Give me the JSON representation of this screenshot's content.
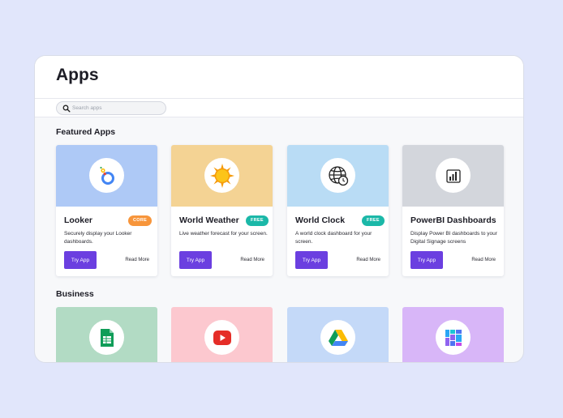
{
  "header": {
    "title": "Apps"
  },
  "search": {
    "placeholder": "Search apps",
    "icon": "search-icon"
  },
  "sections": {
    "featured": "Featured Apps",
    "business": "Business"
  },
  "featured_apps": [
    {
      "name": "Looker",
      "badge": "CORE",
      "badge_color": "#f7953b",
      "bg": "#aec9f6",
      "icon": "looker-icon",
      "desc": "Securely display your Looker dashboards.",
      "try": "Try App",
      "more": "Read More"
    },
    {
      "name": "World Weather",
      "badge": "FREE",
      "badge_color": "#1bb8a8",
      "bg": "#f4d394",
      "icon": "sun-icon",
      "desc": "Live weather forecast for your screen.",
      "try": "Try App",
      "more": "Read More"
    },
    {
      "name": "World Clock",
      "badge": "FREE",
      "badge_color": "#1bb8a8",
      "bg": "#b9dcf5",
      "icon": "globe-clock-icon",
      "desc": "A world clock dashboard for your screen.",
      "try": "Try App",
      "more": "Read More"
    },
    {
      "name": "PowerBI Dashboards",
      "badge": "",
      "badge_color": "",
      "bg": "#d3d6dc",
      "icon": "powerbi-icon",
      "desc": "Display Power BI dashboards to your Digital Signage screens",
      "try": "Try App",
      "more": "Read More"
    }
  ],
  "business_apps": [
    {
      "bg": "#b2dbc4",
      "icon": "google-sheets-icon"
    },
    {
      "bg": "#fcc8cf",
      "icon": "youtube-icon"
    },
    {
      "bg": "#c4d9f8",
      "icon": "google-drive-icon"
    },
    {
      "bg": "#d8b6f8",
      "icon": "grid-tiles-icon"
    }
  ]
}
